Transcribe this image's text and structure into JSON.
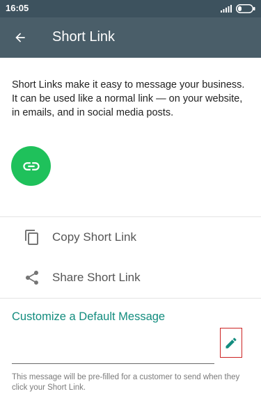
{
  "status_bar": {
    "time": "16:05"
  },
  "app_bar": {
    "title": "Short Link",
    "back_icon": "arrow-back-icon"
  },
  "description": "Short Links make it easy to message your business. It can be used like a normal link — on your website, in emails, and in social media posts.",
  "link_badge": {
    "icon": "link-icon",
    "color": "#1fc15b"
  },
  "actions": [
    {
      "label": "Copy Short Link",
      "icon": "copy-icon"
    },
    {
      "label": "Share Short Link",
      "icon": "share-icon"
    }
  ],
  "customize": {
    "title": "Customize a Default Message",
    "message_value": "",
    "edit_icon": "pencil-icon",
    "hint": "This message will be pre-filled for a customer to send when they click your Short Link."
  },
  "colors": {
    "app_bar": "#4a5e69",
    "status_bar": "#3d525e",
    "accent": "#128c7e",
    "highlight_box": "#cc2222"
  }
}
